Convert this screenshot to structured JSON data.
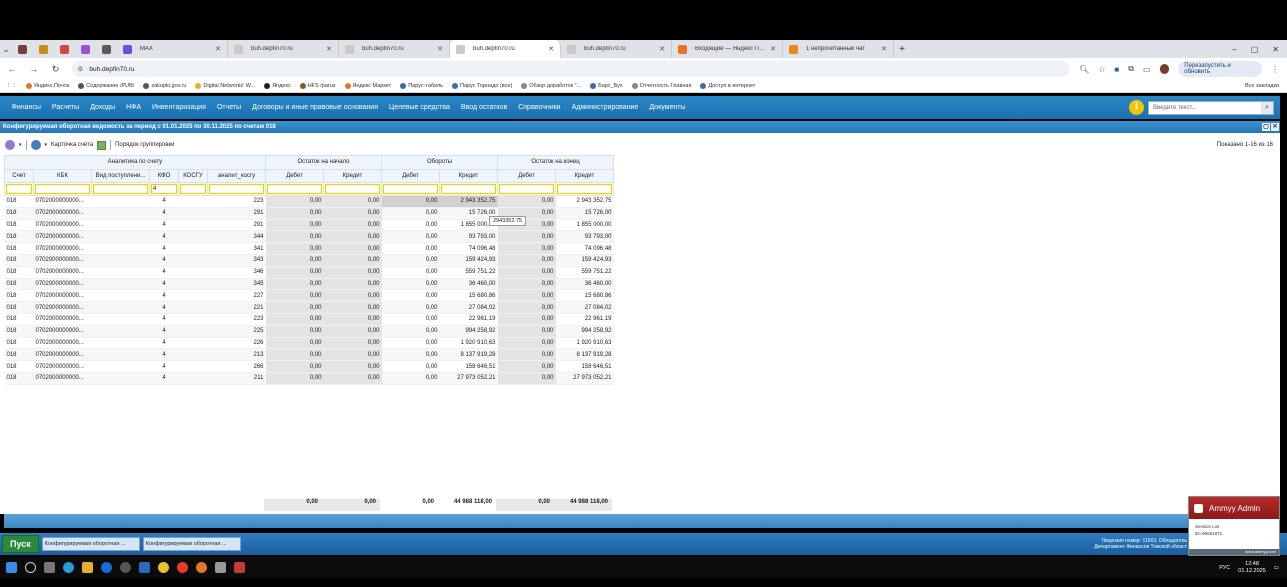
{
  "browser": {
    "tabs": [
      {
        "label": "",
        "color": "#7a3b3b",
        "pinned": true
      },
      {
        "label": "",
        "color": "#c98a1a",
        "pinned": true
      },
      {
        "label": "",
        "color": "#d4473f",
        "pinned": true
      },
      {
        "label": "",
        "color": "#9b4fd6",
        "pinned": true
      },
      {
        "label": "",
        "color": "#5a5a5a",
        "pinned": true
      },
      {
        "label": "MAX",
        "color": "#6b4fd6",
        "pinned": false
      },
      {
        "label": "buh.depfin70.ru",
        "color": "#c9c9c9",
        "pinned": false
      },
      {
        "label": "buh.depfin70.ru",
        "color": "#c9c9c9",
        "pinned": false
      },
      {
        "label": "buh.depfin70.ru",
        "color": "#c9c9c9",
        "pinned": false,
        "active": true
      },
      {
        "label": "buh.depfin70.ru",
        "color": "#c9c9c9",
        "pinned": false
      },
      {
        "label": "Входящие — Яндекс Почта",
        "color": "#e8742a",
        "pinned": false
      },
      {
        "label": "1 непрочитанный чат",
        "color": "#e88a1a",
        "pinned": false
      }
    ],
    "url": "buh.depfin70.ru",
    "update_button": "Перезапустить и обновить",
    "avatar_letter": "Е",
    "bookmarks": [
      {
        "label": "Яндекс.Почта",
        "color": "#e8742a"
      },
      {
        "label": "Содержание /PUB/",
        "color": "#555"
      },
      {
        "label": "zakupki.gov.ru",
        "color": "#555"
      },
      {
        "label": "Digital Networks' W...",
        "color": "#e8b02a"
      },
      {
        "label": "Яндекс",
        "color": "#222"
      },
      {
        "label": "HFS /parus",
        "color": "#8a5a2a"
      },
      {
        "label": "Яндекс Маркет",
        "color": "#e8742a"
      },
      {
        "label": "Парус-табель",
        "color": "#3a6ab0"
      },
      {
        "label": "Парус Торнадо (все)",
        "color": "#3a6ab0"
      },
      {
        "label": "Обзор доработок \"...",
        "color": "#888"
      },
      {
        "label": "Барс_Бух",
        "color": "#3a6ab0"
      },
      {
        "label": "Отчетность Главная",
        "color": "#888"
      },
      {
        "label": "Доступ в интернет",
        "color": "#3a6ab0"
      }
    ],
    "all_bookmarks": "Все закладки"
  },
  "app": {
    "menu": [
      "Финансы",
      "Расчеты",
      "Доходы",
      "НФА",
      "Инвентаризация",
      "Отчеты",
      "Договоры и иные правовые основания",
      "Целевые средства",
      "Ввод остатков",
      "Справочники",
      "Администрирование",
      "Документы"
    ],
    "search_placeholder": "Введите текст...",
    "page_title": "Конфигурируемая оборотная ведомость за период с 01.01.2025 по 30.11.2025 по счетам 018",
    "toolbar": {
      "account_card": "Карточка счета",
      "grouping": "Порядок группировки",
      "shown": "Показано 1-16 из 16"
    },
    "headers": {
      "group_analytics": "Аналитика по счету",
      "group_open": "Остаток на начало",
      "group_turnover": "Обороты",
      "group_close": "Остаток на конец",
      "cols": [
        "Счет",
        "КБК",
        "Вид поступлени...",
        "КФО",
        "КОСГУ",
        "аналит_косгу",
        "Дебет",
        "Кредит",
        "Дебет",
        "Кредит",
        "Дебет",
        "Кредит"
      ]
    },
    "filter_kfo": "4",
    "rows": [
      [
        "018",
        "0702000000000...",
        "",
        "4",
        "",
        "223",
        "0,00",
        "0,00",
        "0,00",
        "2 943 352,75",
        "0,00",
        "2 943 352,75"
      ],
      [
        "018",
        "0702000000000...",
        "",
        "4",
        "",
        "291",
        "0,00",
        "0,00",
        "0,00",
        "15 726,00",
        "0,00",
        "15 726,00"
      ],
      [
        "018",
        "0702000000000...",
        "",
        "4",
        "",
        "291",
        "0,00",
        "0,00",
        "0,00",
        "1 855 000,00",
        "0,00",
        "1 855 000,00"
      ],
      [
        "018",
        "0702000000000...",
        "",
        "4",
        "",
        "344",
        "0,00",
        "0,00",
        "0,00",
        "93 793,00",
        "0,00",
        "93 793,00"
      ],
      [
        "018",
        "0702000000000...",
        "",
        "4",
        "",
        "341",
        "0,00",
        "0,00",
        "0,00",
        "74 096,48",
        "0,00",
        "74 096,48"
      ],
      [
        "018",
        "0702000000000...",
        "",
        "4",
        "",
        "343",
        "0,00",
        "0,00",
        "0,00",
        "159 424,93",
        "0,00",
        "159 424,93"
      ],
      [
        "018",
        "0702000000000...",
        "",
        "4",
        "",
        "346",
        "0,00",
        "0,00",
        "0,00",
        "559 751,22",
        "0,00",
        "559 751,22"
      ],
      [
        "018",
        "0702000000000...",
        "",
        "4",
        "",
        "345",
        "0,00",
        "0,00",
        "0,00",
        "36 460,00",
        "0,00",
        "36 460,00"
      ],
      [
        "018",
        "0702000000000...",
        "",
        "4",
        "",
        "227",
        "0,00",
        "0,00",
        "0,00",
        "15 680,86",
        "0,00",
        "15 680,86"
      ],
      [
        "018",
        "0702000000000...",
        "",
        "4",
        "",
        "221",
        "0,00",
        "0,00",
        "0,00",
        "27 084,02",
        "0,00",
        "27 084,02"
      ],
      [
        "018",
        "0702000000000...",
        "",
        "4",
        "",
        "223",
        "0,00",
        "0,00",
        "0,00",
        "22 961,19",
        "0,00",
        "22 961,19"
      ],
      [
        "018",
        "0702000000000...",
        "",
        "4",
        "",
        "225",
        "0,00",
        "0,00",
        "0,00",
        "994 258,92",
        "0,00",
        "994 258,92"
      ],
      [
        "018",
        "0702000000000...",
        "",
        "4",
        "",
        "226",
        "0,00",
        "0,00",
        "0,00",
        "1 920 910,63",
        "0,00",
        "1 920 910,63"
      ],
      [
        "018",
        "0702000000000...",
        "",
        "4",
        "",
        "213",
        "0,00",
        "0,00",
        "0,00",
        "8 137 919,28",
        "0,00",
        "8 137 919,28"
      ],
      [
        "018",
        "0702000000000...",
        "",
        "4",
        "",
        "266",
        "0,00",
        "0,00",
        "0,00",
        "158 646,51",
        "0,00",
        "158 646,51"
      ],
      [
        "018",
        "0702000000000...",
        "",
        "4",
        "",
        "211",
        "0,00",
        "0,00",
        "0,00",
        "27 973 052,21",
        "0,00",
        "27 973 052,21"
      ]
    ],
    "tooltip": "2943352.75",
    "totals": [
      "0,00",
      "0,00",
      "0,00",
      "44 988 118,00",
      "0,00",
      "44 988 118,00"
    ],
    "start": "Пуск",
    "tasks": [
      "Конфигурируемая оборотная ...",
      "Конфигурируемая оборотная ..."
    ],
    "license_line1": "Лицензия номер: 11663; Обладатель",
    "license_line2": "Департамент Финансов Томской област"
  },
  "ammyy": {
    "title": "Ammyy Admin",
    "line1": "Session List",
    "line2": "ID=95661871",
    "footer": "www.ammyy.com"
  },
  "windows": {
    "lang": "РУС",
    "time": "12:48",
    "date": "01.12.2025"
  }
}
